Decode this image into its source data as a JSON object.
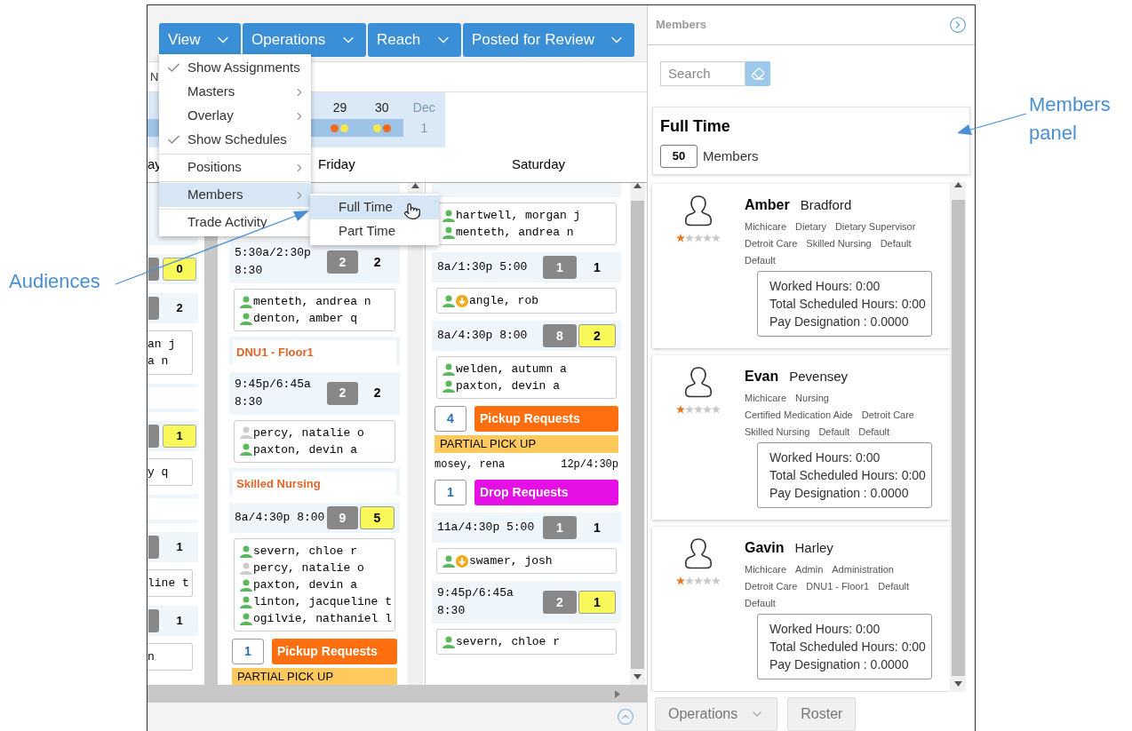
{
  "annotations": [
    {
      "kind": "left",
      "text": "Audiences"
    },
    {
      "kind": "right",
      "text": "Members panel"
    }
  ],
  "toolbar": {
    "menus": [
      {
        "label": "View"
      },
      {
        "label": "Operations"
      },
      {
        "label": "Reach"
      },
      {
        "label": "Posted for Review"
      }
    ]
  },
  "view_menu": {
    "items": [
      {
        "label": "Show Assignments",
        "checked": true,
        "has_submenu": false,
        "selected": false,
        "divider_before": false
      },
      {
        "label": "Masters",
        "checked": false,
        "has_submenu": true,
        "selected": false,
        "divider_before": false
      },
      {
        "label": "Overlay",
        "checked": false,
        "has_submenu": true,
        "selected": false,
        "divider_before": false
      },
      {
        "label": "Show Schedules",
        "checked": true,
        "has_submenu": false,
        "selected": false,
        "divider_before": false
      },
      {
        "label": "Positions",
        "checked": false,
        "has_submenu": true,
        "selected": false,
        "divider_before": true
      },
      {
        "label": "Members",
        "checked": false,
        "has_submenu": true,
        "selected": true,
        "divider_before": true
      },
      {
        "label": "Trade Activity",
        "checked": false,
        "has_submenu": false,
        "selected": false,
        "divider_before": true
      }
    ]
  },
  "members_submenu": {
    "items": [
      {
        "label": "Full Time",
        "selected": true
      },
      {
        "label": "Part Time",
        "selected": false
      }
    ]
  },
  "filter_row": {
    "text": "N"
  },
  "mini_calendar": {
    "days": [
      {
        "label": "29",
        "in_range": true,
        "dots": [
          {
            "color": "#f26a1b"
          },
          {
            "color": "#f5e94a"
          }
        ]
      },
      {
        "label": "30",
        "in_range": true,
        "dots": [
          {
            "color": "#f5e94a"
          },
          {
            "color": "#f26a1b"
          }
        ]
      },
      {
        "label": "Dec",
        "sublabel": "1",
        "in_range": false
      }
    ]
  },
  "day_headers": [
    "ay",
    "Friday",
    "Saturday"
  ],
  "columns": [
    {
      "kind": "partial",
      "blocks": [
        {
          "kind": "spacer"
        },
        {
          "kind": "count",
          "value": "0",
          "highlight": true
        },
        {
          "kind": "count",
          "value": "2",
          "highlight": false
        },
        {
          "kind": "names",
          "lines": [
            "an j",
            "a n"
          ]
        },
        {
          "kind": "header"
        },
        {
          "kind": "count",
          "value": "1",
          "highlight": true
        },
        {
          "kind": "names",
          "lines": [
            "y q"
          ]
        },
        {
          "kind": "header"
        },
        {
          "kind": "count",
          "value": "1",
          "highlight": false
        },
        {
          "kind": "names",
          "lines": [
            "line t"
          ]
        },
        {
          "kind": "count",
          "value": "1",
          "highlight": false
        },
        {
          "kind": "names",
          "lines": [
            "n"
          ]
        }
      ]
    },
    {
      "kind": "day",
      "blocks": [
        {
          "kind": "spacer"
        },
        {
          "kind": "shift",
          "time": "5:30a/2:30p 8:30",
          "assigned": "2",
          "needed": "2",
          "highlight": false
        },
        {
          "kind": "people",
          "people": [
            {
              "name": "menteth, andrea n",
              "confirmed": true,
              "flag": false
            },
            {
              "name": "denton, amber q",
              "confirmed": true,
              "flag": false
            }
          ]
        },
        {
          "kind": "position",
          "title": "DNU1 - Floor1"
        },
        {
          "kind": "shift",
          "time": "9:45p/6:45a 8:30",
          "assigned": "2",
          "needed": "2",
          "highlight": false
        },
        {
          "kind": "people",
          "people": [
            {
              "name": "percy, natalie o",
              "confirmed": false,
              "flag": false
            },
            {
              "name": "paxton, devin a",
              "confirmed": true,
              "flag": false
            }
          ]
        },
        {
          "kind": "position",
          "title": "Skilled Nursing"
        },
        {
          "kind": "shift",
          "time": "8a/4:30p 8:00",
          "assigned": "9",
          "needed": "5",
          "highlight": true
        },
        {
          "kind": "people",
          "people": [
            {
              "name": "severn, chloe r",
              "confirmed": true,
              "flag": false
            },
            {
              "name": "percy, natalie o",
              "confirmed": false,
              "flag": false
            },
            {
              "name": "paxton, devin a",
              "confirmed": true,
              "flag": false
            },
            {
              "name": "linton, jacqueline t",
              "confirmed": true,
              "flag": false
            },
            {
              "name": "ogilvie, nathaniel l",
              "confirmed": true,
              "flag": false
            }
          ]
        },
        {
          "kind": "request",
          "count": "1",
          "label": "Pickup Requests",
          "color": "#ff6f0f"
        },
        {
          "kind": "partial_pickup",
          "label": "PARTIAL PICK UP"
        }
      ]
    },
    {
      "kind": "day",
      "blocks": [
        {
          "kind": "spacer"
        },
        {
          "kind": "people",
          "people": [
            {
              "name": "hartwell, morgan j",
              "confirmed": true,
              "flag": false
            },
            {
              "name": "menteth, andrea n",
              "confirmed": true,
              "flag": false
            }
          ]
        },
        {
          "kind": "shift",
          "time": "8a/1:30p 5:00",
          "assigned": "1",
          "needed": "1",
          "highlight": false
        },
        {
          "kind": "people",
          "people": [
            {
              "name": "angle, rob",
              "confirmed": true,
              "flag": true
            }
          ]
        },
        {
          "kind": "shift",
          "time": "8a/4:30p 8:00",
          "assigned": "8",
          "needed": "2",
          "highlight": true
        },
        {
          "kind": "people",
          "people": [
            {
              "name": "welden, autumn a",
              "confirmed": true,
              "flag": false
            },
            {
              "name": "paxton, devin a",
              "confirmed": true,
              "flag": false
            }
          ]
        },
        {
          "kind": "request",
          "count": "4",
          "label": "Pickup Requests",
          "color": "#ff6f0f"
        },
        {
          "kind": "partial_pickup",
          "label": "PARTIAL PICK UP",
          "name": "mosey, rena",
          "time": "12p/4:30p"
        },
        {
          "kind": "request",
          "count": "1",
          "label": "Drop Requests",
          "color": "#e60fe6"
        },
        {
          "kind": "shift",
          "time": "11a/4:30p 5:00",
          "assigned": "1",
          "needed": "1",
          "highlight": false
        },
        {
          "kind": "people",
          "people": [
            {
              "name": "swamer, josh",
              "confirmed": true,
              "flag": true
            }
          ]
        },
        {
          "kind": "shift",
          "time": "9:45p/6:45a 8:30",
          "assigned": "2",
          "needed": "1",
          "highlight": true
        },
        {
          "kind": "people",
          "people": [
            {
              "name": "severn, chloe r",
              "confirmed": true,
              "flag": false
            }
          ]
        }
      ]
    }
  ],
  "members_panel": {
    "title": "Members",
    "search": {
      "placeholder": "Search"
    },
    "group": {
      "title": "Full Time",
      "count": "50",
      "count_label": "Members"
    },
    "members": [
      {
        "first": "Amber",
        "last": "Bradford",
        "stars": 1,
        "tags": [
          "Michicare",
          "Dietary",
          "Dietary Supervisor",
          "Detroit Care",
          "Skilled Nursing",
          "Default",
          "Default"
        ],
        "stats": [
          "Worked Hours: 0:00",
          "Total Scheduled Hours: 0:00",
          "Pay Designation : 0.0000"
        ]
      },
      {
        "first": "Evan",
        "last": "Pevensey",
        "stars": 1,
        "tags": [
          "Michicare",
          "Nursing",
          "Certified Medication Aide",
          "Detroit Care",
          "Skilled Nursing",
          "Default",
          "Default"
        ],
        "stats": [
          "Worked Hours: 0:00",
          "Total Scheduled Hours: 0:00",
          "Pay Designation : 0.0000"
        ]
      },
      {
        "first": "Gavin",
        "last": "Harley",
        "stars": 1,
        "tags": [
          "Michicare",
          "Admin",
          "Administration",
          "Detroit Care",
          "DNU1 - Floor1",
          "Default",
          "Default"
        ],
        "stats": [
          "Worked Hours: 0:00",
          "Total Scheduled Hours: 0:00",
          "Pay Designation : 0.0000"
        ]
      }
    ],
    "buttons": [
      {
        "kind": "dropdown",
        "label": "Operations"
      },
      {
        "kind": "plain",
        "label": "Roster"
      }
    ]
  }
}
